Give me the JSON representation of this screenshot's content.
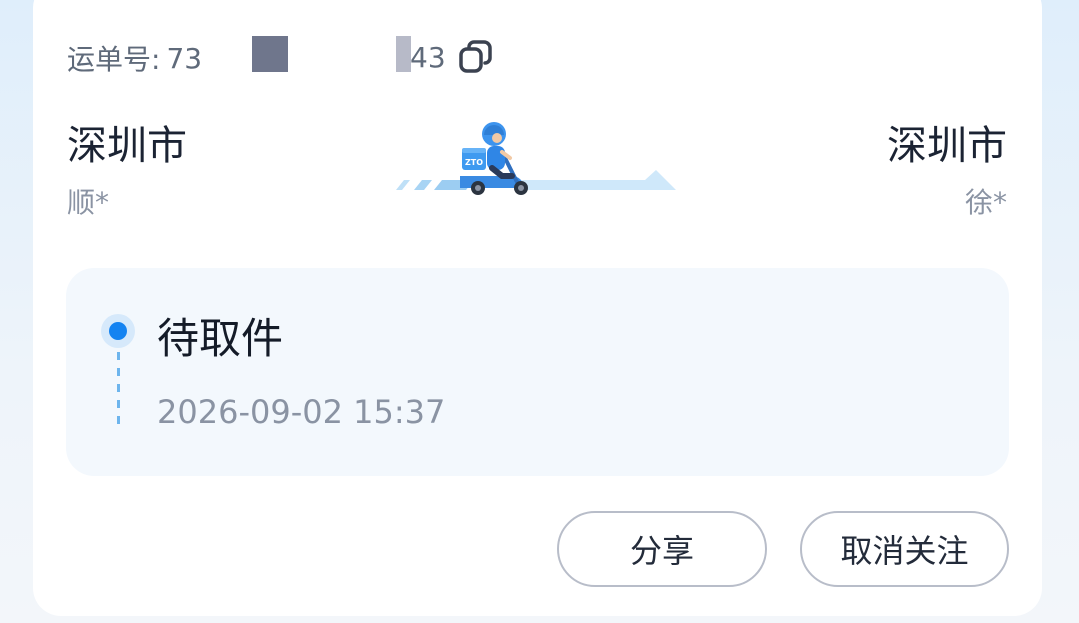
{
  "tracking": {
    "label": "运单号:",
    "number_prefix": "73",
    "number_suffix": "43",
    "copy_icon": "copy-icon"
  },
  "route": {
    "origin": {
      "city": "深圳市",
      "name": "顺*"
    },
    "destination": {
      "city": "深圳市",
      "name": "徐*"
    },
    "courier_badge": "ZTO",
    "courier_graphic": "courier-scooter-icon"
  },
  "status": {
    "title": "待取件",
    "time": "2026-09-02 15:37",
    "accent": "#1483f1"
  },
  "actions": {
    "share_label": "分享",
    "unfollow_label": "取消关注"
  }
}
